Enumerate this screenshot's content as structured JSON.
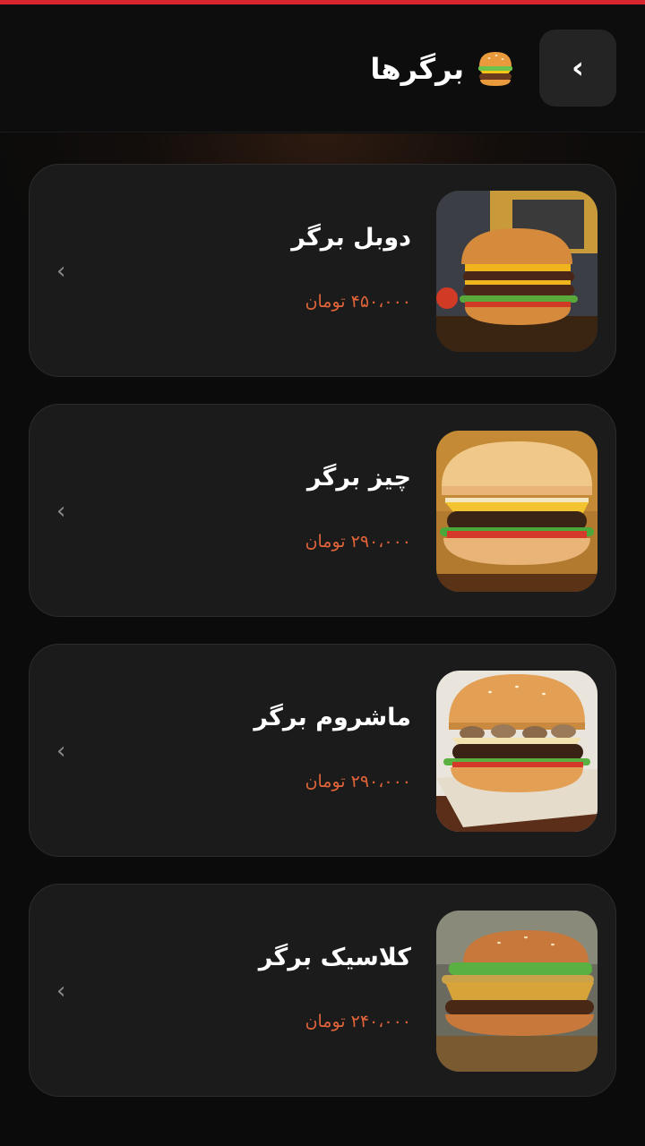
{
  "header": {
    "title": "برگرها",
    "back_icon": "‹",
    "title_icon": "burger-emoji"
  },
  "colors": {
    "accent_strip": "#d8252d",
    "price": "#e0643a",
    "card_bg": "#1b1b1b",
    "page_bg": "#0b0b0b"
  },
  "items": [
    {
      "name": "دوبل برگر",
      "price": "۴۵۰،۰۰۰ تومان",
      "chevron": "‹",
      "image": "double-burger-photo"
    },
    {
      "name": "چیز برگر",
      "price": "۲۹۰،۰۰۰ تومان",
      "chevron": "‹",
      "image": "cheese-burger-photo"
    },
    {
      "name": "ماشروم برگر",
      "price": "۲۹۰،۰۰۰ تومان",
      "chevron": "‹",
      "image": "mushroom-burger-photo"
    },
    {
      "name": "کلاسیک برگر",
      "price": "۲۴۰،۰۰۰ تومان",
      "chevron": "‹",
      "image": "classic-burger-photo"
    }
  ]
}
